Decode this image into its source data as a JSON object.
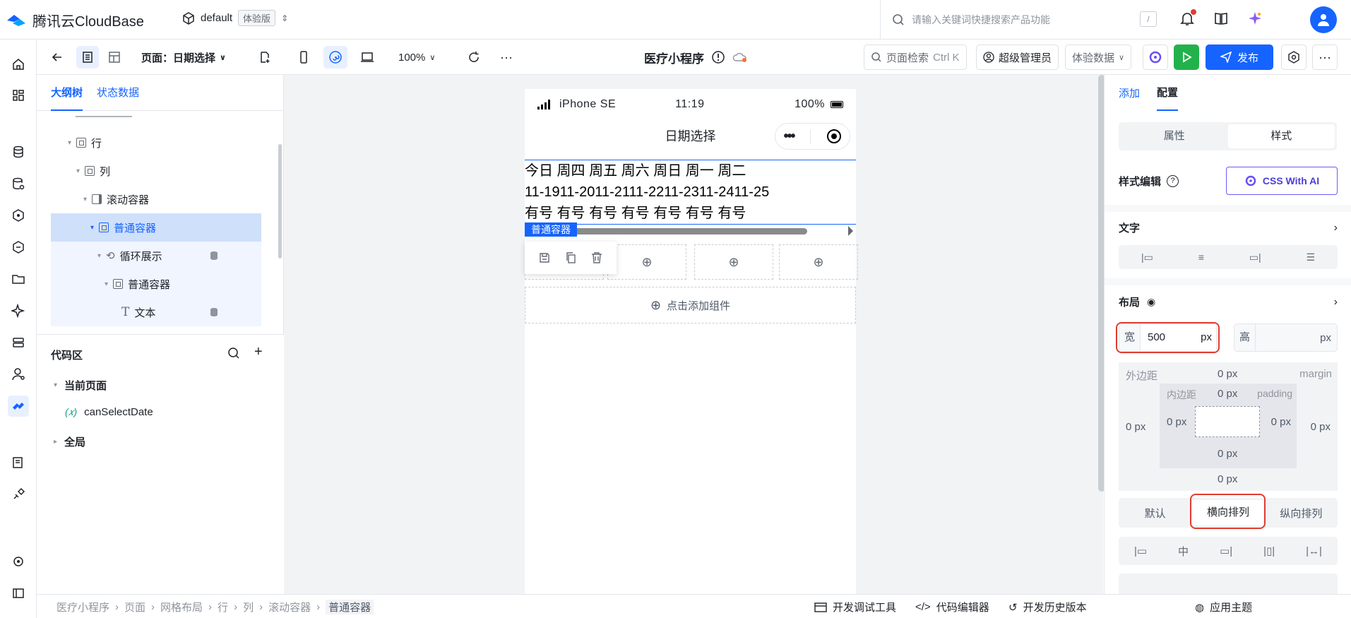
{
  "brand": {
    "name": "腾讯云CloudBase"
  },
  "env": {
    "name": "default",
    "badge": "体验版"
  },
  "top_search": {
    "placeholder": "请输入关键词快捷搜索产品功能",
    "shortcut": "/"
  },
  "toolbar": {
    "page_label": "页面：日期选择",
    "zoom": "100%",
    "app_title": "医疗小程序",
    "page_search": "页面检索",
    "page_search_shortcut": "Ctrl K",
    "role": "超级管理员",
    "data_mode": "体验数据",
    "publish": "发布"
  },
  "outline": {
    "tabs": [
      "大纲树",
      "状态数据"
    ],
    "nodes": [
      {
        "label": "行"
      },
      {
        "label": "列"
      },
      {
        "label": "滚动容器"
      },
      {
        "label": "普通容器"
      },
      {
        "label": "循环展示"
      },
      {
        "label": "普通容器"
      },
      {
        "label": "文本"
      }
    ]
  },
  "code": {
    "title": "代码区",
    "current_page": "当前页面",
    "var_prefix": "(𝑥)",
    "var_name": "canSelectDate",
    "global": "全局"
  },
  "phone": {
    "device": "iPhone SE",
    "time": "11:19",
    "battery": "100%",
    "title": "日期选择",
    "line1": "今日 周四 周五 周六 周日 周一 周二",
    "line2": "11-1911-2011-2111-2211-2311-2411-25",
    "line3": "有号 有号 有号 有号 有号 有号 有号",
    "container_label": "普通容器",
    "add_component": "点击添加组件"
  },
  "props": {
    "tabs": [
      "添加",
      "配置"
    ],
    "seg": [
      "属性",
      "样式"
    ],
    "style_edit": "样式编辑",
    "css_ai": "CSS With AI",
    "text_section": "文字",
    "layout_section": "布局",
    "width_label": "宽",
    "width_value": "500",
    "width_unit": "px",
    "height_label": "高",
    "height_unit": "px",
    "margin_cn": "外边距",
    "margin_en": "margin",
    "padding_cn": "内边距",
    "padding_en": "padding",
    "zero_px": "0 px",
    "arrange": [
      "默认",
      "横向排列",
      "纵向排列"
    ]
  },
  "bottom": {
    "breadcrumb": [
      "医疗小程序",
      "页面",
      "网格布局",
      "行",
      "列",
      "滚动容器",
      "普通容器"
    ],
    "debug_tool": "开发调试工具",
    "code_editor": "代码编辑器",
    "history": "开发历史版本",
    "theme": "应用主题"
  },
  "colors": {
    "accent": "#1664ff",
    "publish_green": "#22b24c",
    "highlight_red": "#e03c2f"
  }
}
